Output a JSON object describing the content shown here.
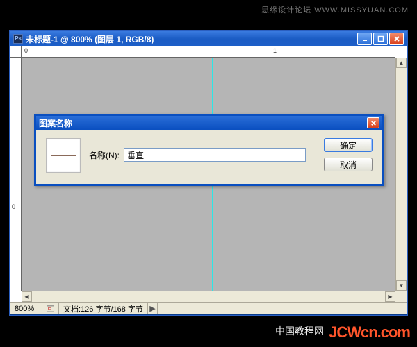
{
  "watermark_top": "思缘设计论坛 WWW.MISSYUAN.COM",
  "watermark_bottom_cn": "中国教程网",
  "watermark_bottom_en": "JCWcn.com",
  "window": {
    "app_icon_text": "Ps",
    "title": "未标题-1 @ 800% (图层 1, RGB/8)"
  },
  "ruler": {
    "h_ticks": [
      {
        "label": "0",
        "pos": 4
      },
      {
        "label": "1",
        "pos": 362
      }
    ],
    "v_ticks": [
      {
        "label": "0",
        "pos": 210
      }
    ]
  },
  "canvas": {
    "guide_left_pct": 51
  },
  "statusbar": {
    "zoom": "800%",
    "docinfo": "文档:126 字节/168 字节"
  },
  "dialog": {
    "title": "图案名称",
    "name_label": "名称(N):",
    "name_value": "垂直",
    "ok_label": "确定",
    "cancel_label": "取消"
  }
}
